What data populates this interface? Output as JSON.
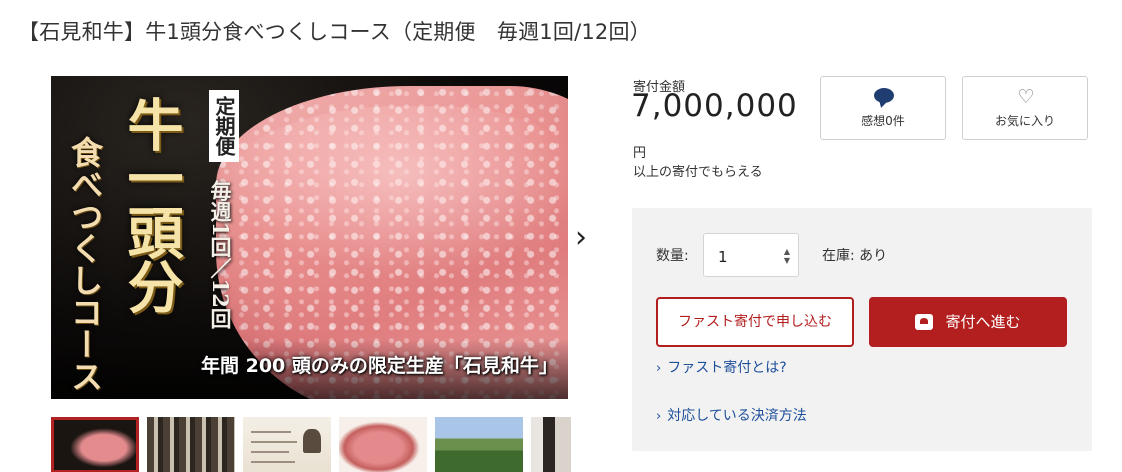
{
  "page": {
    "title": "【石見和牛】牛1頭分食べつくしコース（定期便　毎週1回/12回）"
  },
  "gallery": {
    "hero": {
      "big_text": "牛一頭分",
      "side_text": "食べつくしコース",
      "badge_text": "定期便",
      "frequency_text": "毎週1回／12回",
      "caption": "年間 200 頭のみの限定生産「石見和牛」"
    },
    "next_icon": "chevron-right-icon",
    "next_glyph": "›",
    "thumbnail_count": 6,
    "active_thumbnail_index": 0
  },
  "donation": {
    "amount_label": "寄付金額",
    "amount": "7,000,000",
    "currency": "円",
    "note": "以上の寄付でもらえる"
  },
  "actions": {
    "review_label": "感想0件",
    "review_icon": "speech-bubble-icon",
    "favorite_label": "お気に入り",
    "favorite_icon": "heart-outline-icon",
    "favorite_glyph": "♡"
  },
  "order_panel": {
    "qty_label": "数量:",
    "qty_value": "1",
    "stock_text": "在庫: あり",
    "fast_button": "ファスト寄付で申し込む",
    "donate_button": "寄付へ進む",
    "donate_icon": "envelope-heart-icon",
    "link_fast": "ファスト寄付とは?",
    "link_payment": "対応している決済方法",
    "link_chevron": "›"
  },
  "colors": {
    "accent_red": "#b31f1f",
    "link_blue": "#1d4f9a",
    "review_icon": "#1f3d70",
    "panel_bg": "#f2f2f2"
  }
}
